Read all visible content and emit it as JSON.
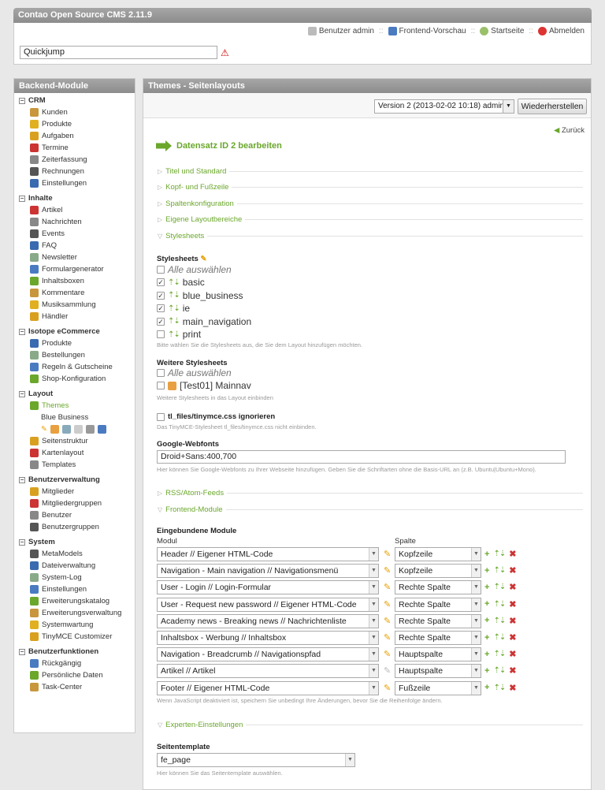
{
  "app_title": "Contao Open Source CMS 2.11.9",
  "toplinks": {
    "user": "Benutzer admin",
    "preview": "Frontend-Vorschau",
    "home": "Startseite",
    "logout": "Abmelden"
  },
  "quickjump": {
    "value": "Quickjump"
  },
  "sidebar": {
    "title": "Backend-Module",
    "groups": [
      {
        "label": "CRM",
        "items": [
          "Kunden",
          "Produkte",
          "Aufgaben",
          "Termine",
          "Zeiterfassung",
          "Rechnungen",
          "Einstellungen"
        ]
      },
      {
        "label": "Inhalte",
        "items": [
          "Artikel",
          "Nachrichten",
          "Events",
          "FAQ",
          "Newsletter",
          "Formulargenerator",
          "Inhaltsboxen",
          "Kommentare",
          "Musiksammlung",
          "Händler"
        ]
      },
      {
        "label": "Isotope eCommerce",
        "items": [
          "Produkte",
          "Bestellungen",
          "Regeln & Gutscheine",
          "Shop-Konfiguration"
        ]
      },
      {
        "label": "Layout",
        "items": [
          "Themes",
          "Blue Business",
          "",
          "Seitenstruktur",
          "Kartenlayout",
          "Templates"
        ]
      },
      {
        "label": "Benutzerverwaltung",
        "items": [
          "Mitglieder",
          "Mitgliedergruppen",
          "Benutzer",
          "Benutzergruppen"
        ]
      },
      {
        "label": "System",
        "items": [
          "MetaModels",
          "Dateiverwaltung",
          "System-Log",
          "Einstellungen",
          "Erweiterungskatalog",
          "Erweiterungsverwaltung",
          "Systemwartung",
          "TinyMCE Customizer"
        ]
      },
      {
        "label": "Benutzerfunktionen",
        "items": [
          "Rückgängig",
          "Persönliche Daten",
          "Task-Center"
        ]
      }
    ]
  },
  "main": {
    "title": "Themes - Seitenlayouts",
    "version": "Version 2 (2013-02-02 10:18) admin",
    "restore": "Wiederherstellen",
    "back": "Zurück",
    "heading": "Datensatz ID 2 bearbeiten",
    "legends": [
      "Titel und Standard",
      "Kopf- und Fußzeile",
      "Spaltenkonfiguration",
      "Eigene Layoutbereiche",
      "Stylesheets",
      "RSS/Atom-Feeds",
      "Frontend-Module",
      "Experten-Einstellungen"
    ],
    "stylesheets_label": "Stylesheets",
    "select_all": "Alle auswählen",
    "stylesheets": [
      "basic",
      "blue_business",
      "ie",
      "main_navigation",
      "print"
    ],
    "stylesheets_tip": "Bitte wählen Sie die Stylesheets aus, die Sie dem Layout hinzufügen möchten.",
    "ext_label": "Weitere Stylesheets",
    "ext_item": "[Test01] Mainnav",
    "ext_tip": "Weitere Stylesheets in das Layout einbinden",
    "tiny_label": "tl_files/tinymce.css ignorieren",
    "tiny_tip": "Das TinyMCE-Stylesheet tl_files/tinymce.css nicht einbinden.",
    "webfonts_label": "Google-Webfonts",
    "webfonts_value": "Droid+Sans:400,700",
    "webfonts_tip": "Hier können Sie Google-Webfonts zu Ihrer Webseite hinzufügen. Geben Sie die Schriftarten ohne die Basis-URL an (z.B. Ubuntu|Ubuntu+Mono).",
    "modules_label": "Eingebundene Module",
    "col_module": "Modul",
    "col_column": "Spalte",
    "modules": [
      {
        "module": "Header // Eigener HTML-Code",
        "column": "Kopfzeile"
      },
      {
        "module": "Navigation - Main navigation // Navigationsmenü",
        "column": "Kopfzeile"
      },
      {
        "module": "User - Login // Login-Formular",
        "column": "Rechte Spalte"
      },
      {
        "module": "User - Request new password // Eigener HTML-Code",
        "column": "Rechte Spalte"
      },
      {
        "module": "Academy news - Breaking news // Nachrichtenliste",
        "column": "Rechte Spalte"
      },
      {
        "module": "Inhaltsbox - Werbung // Inhaltsbox",
        "column": "Rechte Spalte"
      },
      {
        "module": "Navigation - Breadcrumb // Navigationspfad",
        "column": "Hauptspalte"
      },
      {
        "module": "Artikel // Artikel",
        "column": "Hauptspalte"
      },
      {
        "module": "Footer // Eigener HTML-Code",
        "column": "Fußzeile"
      }
    ],
    "modules_tip": "Wenn JavaScript deaktiviert ist, speichern Sie unbedingt Ihre Änderungen, bevor Sie die Reihenfolge ändern.",
    "template_label": "Seitentemplate",
    "template_value": "fe_page",
    "template_tip": "Hier können Sie das Seitentemplate auswählen."
  }
}
